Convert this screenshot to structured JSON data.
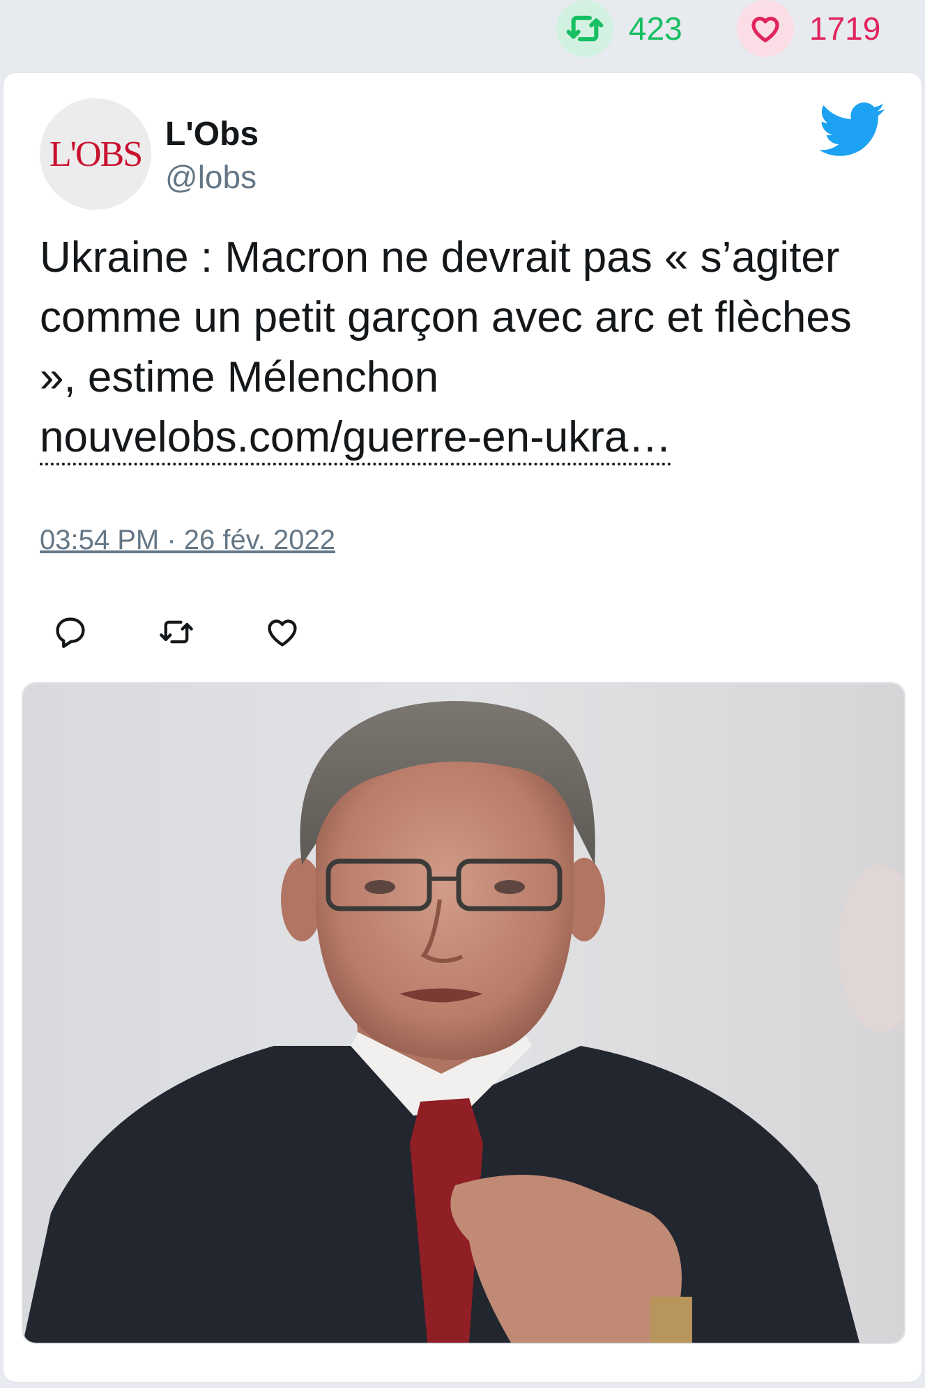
{
  "engagement": {
    "retweets": "423",
    "likes": "1719"
  },
  "tweet": {
    "author": {
      "name": "L'Obs",
      "handle": "@lobs",
      "avatar_text": "L'OBS"
    },
    "text": "Ukraine : Macron ne devrait pas « s’agiter comme un petit garçon avec arc et flèches », estime Mélenchon",
    "link": "nouvelobs.com/guerre-en-ukra…",
    "timestamp": "03:54 PM · 26 fév. 2022"
  },
  "icons": {
    "retweet": "retweet-icon",
    "like": "heart-icon",
    "reply": "reply-icon",
    "brand": "twitter-bird-icon"
  },
  "colors": {
    "retweet": "#17bf63",
    "like": "#e0245e",
    "brand": "#1da1f2",
    "text": "#14171a",
    "muted": "#657786"
  }
}
